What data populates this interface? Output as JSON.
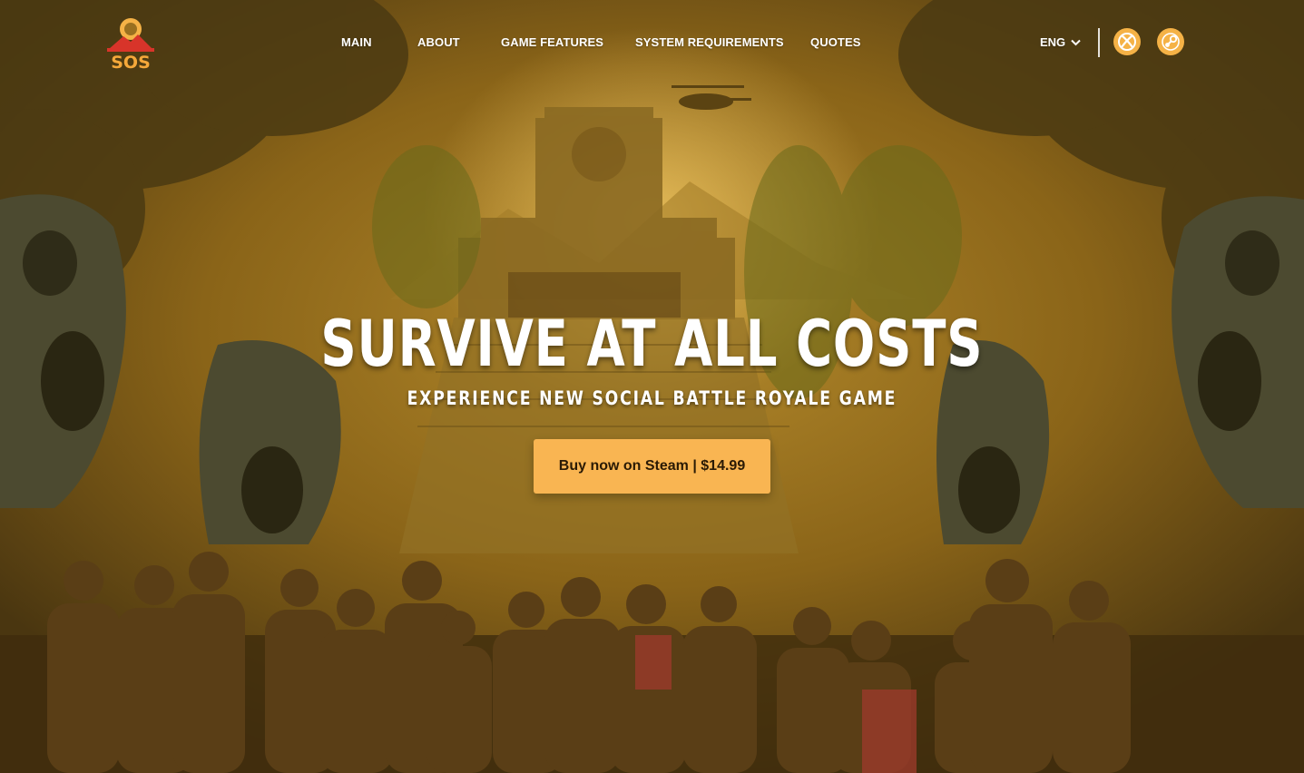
{
  "brand": {
    "logo_text": "SOS"
  },
  "nav": {
    "items": [
      {
        "label": "MAIN"
      },
      {
        "label": "ABOUT"
      },
      {
        "label": "GAME FEATURES"
      },
      {
        "label": "SYSTEM REQUIREMENTS"
      },
      {
        "label": "QUOTES"
      }
    ],
    "language": "ENG",
    "platforms": [
      "xbox-icon",
      "steam-icon"
    ]
  },
  "hero": {
    "headline": "SURVIVE AT ALL COSTS",
    "subheadline": "EXPERIENCE NEW SOCIAL BATTLE ROYALE GAME",
    "cta_label": "Buy now on Steam | $14.99"
  },
  "colors": {
    "accent": "#f9b552",
    "icon_bg": "#f5b246",
    "logo_red": "#d8342a",
    "text": "#ffffff"
  }
}
